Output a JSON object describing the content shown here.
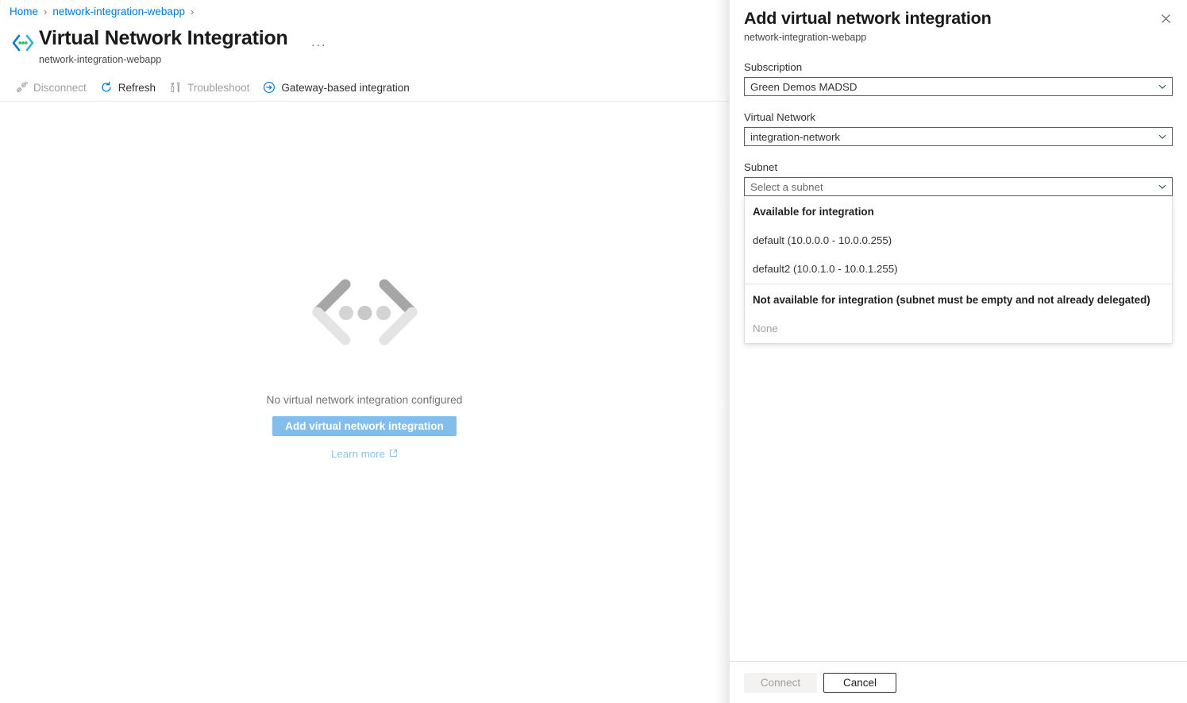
{
  "breadcrumb": {
    "items": [
      {
        "label": "Home"
      },
      {
        "label": "network-integration-webapp"
      }
    ],
    "separator": "›"
  },
  "header": {
    "title": "Virtual Network Integration",
    "subtitle": "network-integration-webapp",
    "icon": "vnet-integration-icon",
    "more_label": "···"
  },
  "toolbar": {
    "items": [
      {
        "label": "Disconnect",
        "icon": "disconnect-icon",
        "disabled": true
      },
      {
        "label": "Refresh",
        "icon": "refresh-icon",
        "disabled": false
      },
      {
        "label": "Troubleshoot",
        "icon": "troubleshoot-icon",
        "disabled": true
      },
      {
        "label": "Gateway-based integration",
        "icon": "arrow-right-circle-icon",
        "disabled": false
      }
    ]
  },
  "empty_state": {
    "icon": "vnet-chevrons-dots-icon",
    "message": "No virtual network integration configured",
    "primary_button": "Add virtual network integration",
    "link_label": "Learn more",
    "link_icon": "external-link-icon"
  },
  "panel": {
    "title": "Add virtual network integration",
    "subtitle": "network-integration-webapp",
    "close_icon": "close-icon",
    "fields": {
      "subscription": {
        "label": "Subscription",
        "value": "Green Demos MADSD",
        "chevron": "chevron-down-icon"
      },
      "virtual_network": {
        "label": "Virtual Network",
        "value": "integration-network",
        "chevron": "chevron-down-icon"
      },
      "subnet": {
        "label": "Subnet",
        "placeholder": "Select a subnet",
        "value": "",
        "chevron": "chevron-down-icon",
        "dropdown_open": true,
        "groups": [
          {
            "header": "Available for integration",
            "options": [
              {
                "label": "default (10.0.0.0 - 10.0.0.255)",
                "disabled": false
              },
              {
                "label": "default2 (10.0.1.0 - 10.0.1.255)",
                "disabled": false
              }
            ]
          },
          {
            "header": "Not available for integration (subnet must be empty and not already delegated)",
            "options": [
              {
                "label": "None",
                "disabled": true
              }
            ]
          }
        ]
      }
    },
    "footer": {
      "connect_label": "Connect",
      "connect_disabled": true,
      "cancel_label": "Cancel"
    }
  },
  "colors": {
    "accent": "#0078d4",
    "link": "#0078d4",
    "faded_primary": "#83bdeb",
    "faded_link": "#8ec2ea",
    "text": "#323130",
    "muted": "#a19f9d"
  }
}
